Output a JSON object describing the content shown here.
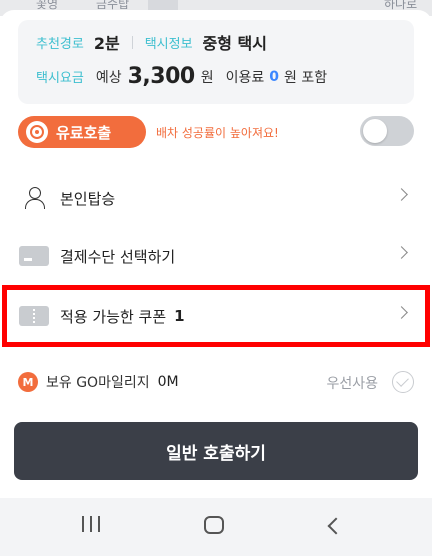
{
  "map": {
    "labels": [
      "꽃영",
      "금수탑",
      "하나로"
    ]
  },
  "info_card": {
    "route_label": "추천경로",
    "route_value": "2분",
    "taxi_info_label": "택시정보",
    "taxi_info_value": "중형 택시",
    "fare_label": "택시요금",
    "fare_prefix": "예상",
    "fare_value": "3,300",
    "fare_unit": "원",
    "fee_label": "이용료",
    "fee_value": "0",
    "fee_suffix": "원 포함"
  },
  "premium": {
    "button_label": "유료호출",
    "hint": "배차 성공률이 높아져요!",
    "toggle_on": false
  },
  "menu": {
    "self_boarding": "본인탑승",
    "payment": "결제수단 선택하기",
    "coupon_label": "적용 가능한 쿠폰",
    "coupon_count": "1"
  },
  "mileage": {
    "icon_text": "M",
    "label": "보유 GO마일리지",
    "value": "0M",
    "use_label": "우선사용"
  },
  "cta": {
    "label": "일반 호출하기"
  },
  "colors": {
    "accent": "#f26d3d",
    "teal": "#3dbfcf",
    "cta_bg": "#3b3f48",
    "highlight": "#ff0000"
  },
  "icons": [
    "target-icon",
    "person-icon",
    "card-icon",
    "coupon-icon",
    "mileage-icon",
    "check-icon",
    "chevron-right-icon"
  ]
}
